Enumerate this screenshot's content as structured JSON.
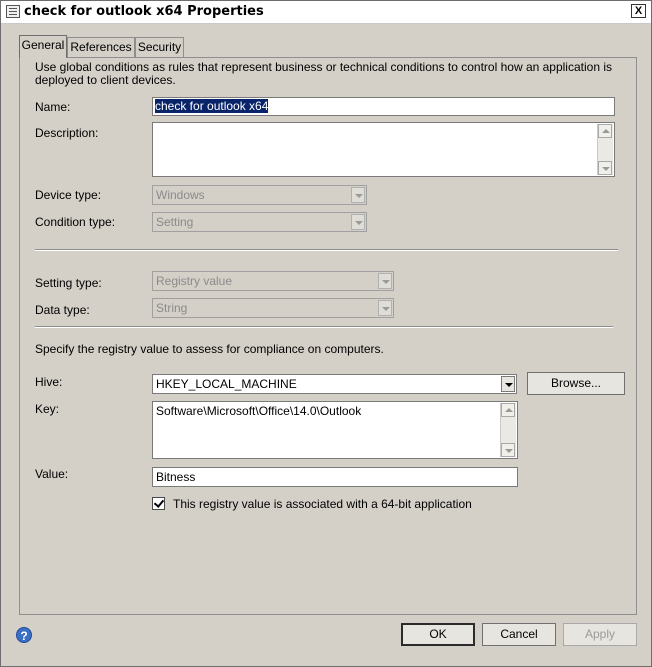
{
  "window": {
    "title": "check for outlook x64 Properties",
    "close_glyph": "X"
  },
  "tabs": [
    {
      "label": "General"
    },
    {
      "label": "References"
    },
    {
      "label": "Security"
    }
  ],
  "general": {
    "description_hint": "Use global conditions as rules that represent business or technical conditions to control how an application is deployed to client devices.",
    "name_label": "Name:",
    "name_value": "check for outlook x64",
    "description_label": "Description:",
    "description_value": "",
    "device_type_label": "Device type:",
    "device_type_value": "Windows",
    "condition_type_label": "Condition type:",
    "condition_type_value": "Setting",
    "setting_type_label": "Setting type:",
    "setting_type_value": "Registry value",
    "data_type_label": "Data type:",
    "data_type_value": "String",
    "registry_hint": "Specify the registry value to assess for compliance on computers.",
    "hive_label": "Hive:",
    "hive_value": "HKEY_LOCAL_MACHINE",
    "browse_label": "Browse...",
    "key_label": "Key:",
    "key_value": "Software\\Microsoft\\Office\\14.0\\Outlook",
    "value_label": "Value:",
    "value_value": "Bitness",
    "checkbox_label": "This registry value is associated with a 64-bit application",
    "checkbox_checked": true
  },
  "footer": {
    "ok_label": "OK",
    "cancel_label": "Cancel",
    "apply_label": "Apply",
    "help_glyph": "?"
  }
}
